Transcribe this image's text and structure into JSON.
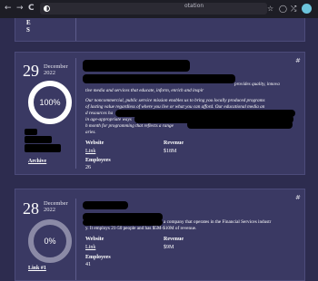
{
  "browser": {
    "back_icon": "←",
    "forward_icon": "→",
    "reload_icon": "C",
    "url_fragment": "otation",
    "star_icon": "☆",
    "pocket_icon": "◯",
    "extensions_icon": "⤮",
    "account_icon": "●"
  },
  "top_card": {
    "letters": [
      "E",
      "S"
    ]
  },
  "entries": [
    {
      "day": "29",
      "month": "December",
      "year": "2022",
      "percent": "100%",
      "percent_value": 100,
      "description_lines": [
        "provides quality, innova",
        "tive media and services that educate, inform, enrich and inspir",
        "Our noncommercial, public service mission enables us to bring you locally produced programs",
        "of lasting value regardless of where you live or what you can afford. Our educational media an",
        "d resources ha",
        "in age-appropriate ways",
        "h month for programming that reflects a range",
        "aries."
      ],
      "website_label": "Website",
      "website_value": "Link",
      "revenue_label": "Revenue",
      "revenue_value": "$18M",
      "employees_label": "Employees",
      "employees_value": "26",
      "bottom_link": "Archive",
      "hash": "#"
    },
    {
      "day": "28",
      "month": "December",
      "year": "2022",
      "percent": "0%",
      "percent_value": 0,
      "description_lines": [
        "a company that operates in the Financial Services industr",
        "y. It employs 21-50 people and has $5M-$10M of revenue."
      ],
      "website_label": "Website",
      "website_value": "Link",
      "revenue_label": "Revenue",
      "revenue_value": "$9M",
      "employees_label": "Employees",
      "employees_value": "41",
      "bottom_link": "Link #1",
      "hash": "#"
    }
  ]
}
